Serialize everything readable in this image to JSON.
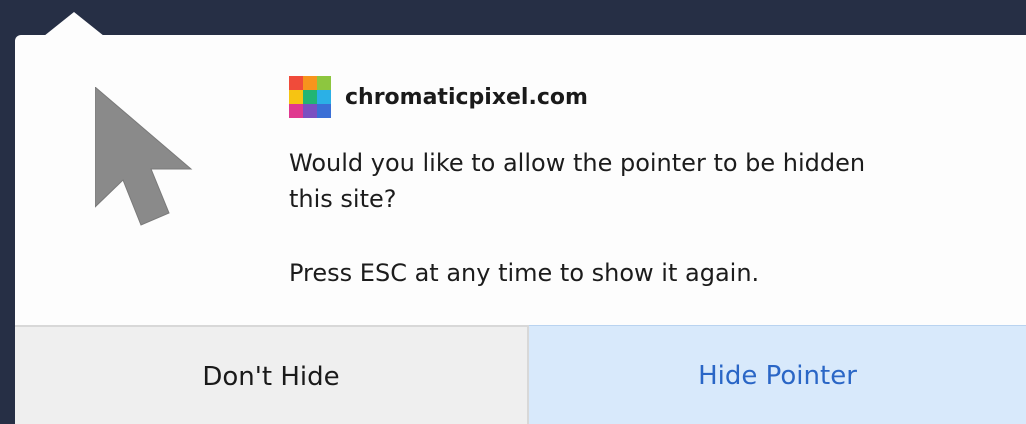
{
  "popup": {
    "site": "chromaticpixel.com",
    "message": "Would you like to allow the pointer to be hidden this site?",
    "hint": "Press ESC at any time to show it again.",
    "favicon_colors": [
      "#f04b3a",
      "#f7941d",
      "#8dc63f",
      "#f6c412",
      "#22b573",
      "#2bb0e6",
      "#e0388f",
      "#7b4fc1",
      "#3a6fd6"
    ]
  },
  "buttons": {
    "dont_hide": "Don't Hide",
    "hide_pointer": "Hide Pointer"
  },
  "colors": {
    "background": "#262f45",
    "popup": "#fdfdfd",
    "primary_button_bg": "#d8e9fb",
    "primary_button_text": "#2a66c6",
    "secondary_button_bg": "#efefef"
  }
}
